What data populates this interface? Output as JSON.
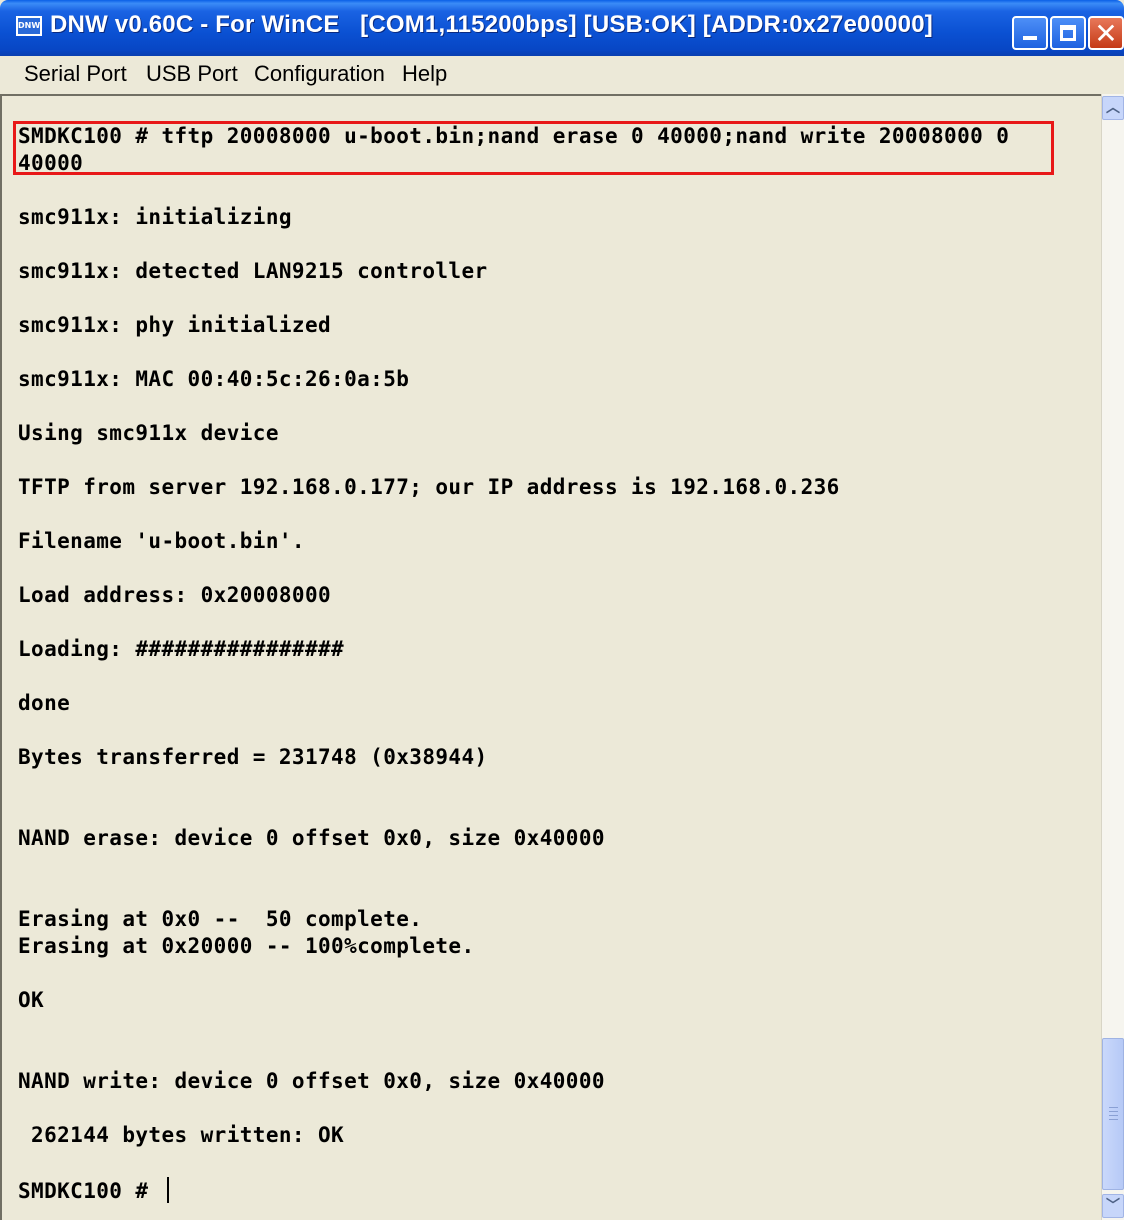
{
  "window": {
    "title": "DNW v0.60C - For WinCE   [COM1,115200bps] [USB:OK] [ADDR:0x27e00000]",
    "icon_label": "DNW",
    "controls": {
      "minimize": "minimize-icon",
      "maximize": "maximize-icon",
      "close": "close-icon"
    }
  },
  "menu": [
    "Serial Port",
    "USB Port",
    "Configuration",
    "Help"
  ],
  "terminal": {
    "lines": [
      "SMDKC100 # tftp 20008000 u-boot.bin;nand erase 0 40000;nand write 20008000 0",
      "40000",
      "smc911x: initializing",
      "smc911x: detected LAN9215 controller",
      "smc911x: phy initialized",
      "smc911x: MAC 00:40:5c:26:0a:5b",
      "Using smc911x device",
      "TFTP from server 192.168.0.177; our IP address is 192.168.0.236",
      "Filename 'u-boot.bin'.",
      "Load address: 0x20008000",
      "Loading: ################",
      "done",
      "Bytes transferred = 231748 (0x38944)",
      "NAND erase: device 0 offset 0x0, size 0x40000",
      "Erasing at 0x0 --  50 complete.",
      "Erasing at 0x20000 -- 100%complete.",
      "OK",
      "NAND write: device 0 offset 0x0, size 0x40000",
      " 262144 bytes written: OK",
      "SMDKC100 # "
    ]
  },
  "colors": {
    "highlight": "#e81818",
    "titlebar": "#0a50d2"
  }
}
